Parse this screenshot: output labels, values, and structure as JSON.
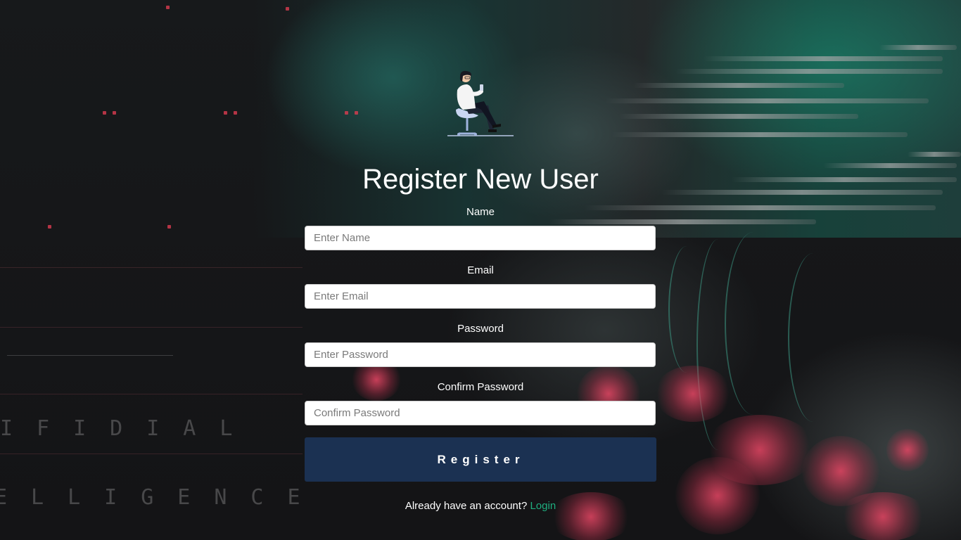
{
  "page": {
    "title": "Register New User"
  },
  "form": {
    "name": {
      "label": "Name",
      "placeholder": "Enter Name",
      "value": ""
    },
    "email": {
      "label": "Email",
      "placeholder": "Enter Email",
      "value": ""
    },
    "password": {
      "label": "Password",
      "placeholder": "Enter Password",
      "value": ""
    },
    "confirm_password": {
      "label": "Confirm Password",
      "placeholder": "Confirm Password",
      "value": ""
    },
    "submit_label": "Register"
  },
  "footer": {
    "prompt": "Already have an account?",
    "login_link": "Login"
  },
  "background": {
    "side_text_top": "IFIDIAL",
    "side_text_bottom": "ELLIGENCE"
  },
  "colors": {
    "button_bg": "#1b3152",
    "link": "#1fae7f",
    "page_bg": "#141416"
  },
  "icons": {
    "illustration": "person-sitting-on-chair-with-phone"
  }
}
